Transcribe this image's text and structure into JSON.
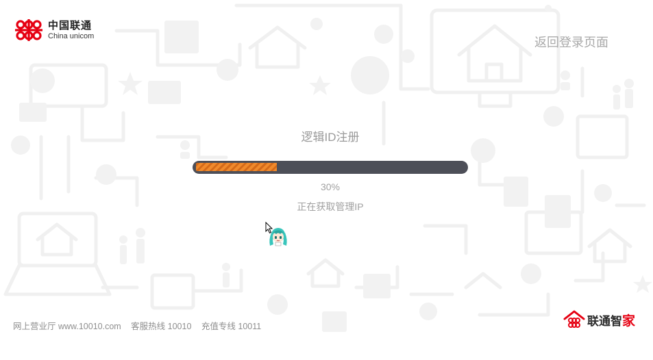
{
  "logo": {
    "name_cn": "中国联通",
    "name_en": "China unicom"
  },
  "header": {
    "back_link": "返回登录页面"
  },
  "main": {
    "title": "逻辑ID注册",
    "progress": {
      "fraction": 0.3,
      "percent_label": "30%"
    },
    "status_text": "正在获取管理IP"
  },
  "footer": {
    "hall": "网上营业厅 www.10010.com",
    "service": "客服热线 10010",
    "recharge": "充值专线 10011"
  },
  "brand": {
    "name_main": "联通智",
    "name_accent": "家"
  },
  "colors": {
    "progress_fill": "#f08a2c",
    "progress_track": "#4d4f58",
    "brand_red": "#e60012"
  },
  "icons": {
    "logo": "china-unicom-knot-icon",
    "brand": "smart-home-icon",
    "mascot": "anime-mascot-icon",
    "cursor": "mouse-pointer-icon"
  }
}
